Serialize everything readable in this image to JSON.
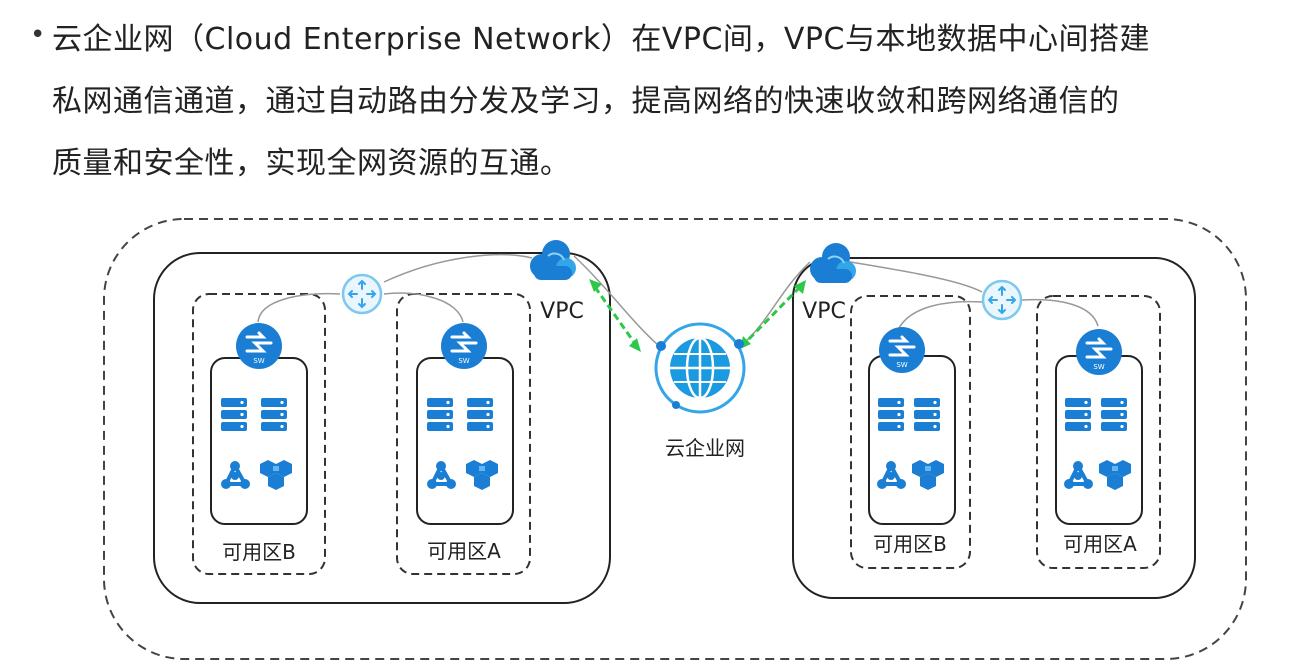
{
  "text": {
    "bullet": "•",
    "line1": "云企业网（Cloud Enterprise Network）在VPC间，VPC与本地数据中心间搭建",
    "line2": "私网通信通道，通过自动路由分发及学习，提高网络的快速收敛和跨网络通信的",
    "line3": "质量和安全性，实现全网资源的互通。"
  },
  "diagram": {
    "center_label": "云企业网",
    "left_vpc_label": "VPC",
    "right_vpc_label": "VPC",
    "left_zone_b_label": "可用区B",
    "left_zone_a_label": "可用区A",
    "right_zone_b_label": "可用区B",
    "right_zone_a_label": "可用区A",
    "switch_text": "SW"
  },
  "colors": {
    "icon_blue": "#1a7fd4",
    "icon_light_blue": "#33a6e8",
    "router_ring": "#7cc8ee",
    "link_green": "#2dc84a"
  },
  "icons": [
    "cloud-vpc-icon",
    "router-icon",
    "switch-icon",
    "server-icon",
    "network-node-icon",
    "hex-cluster-icon",
    "globe-icon"
  ]
}
